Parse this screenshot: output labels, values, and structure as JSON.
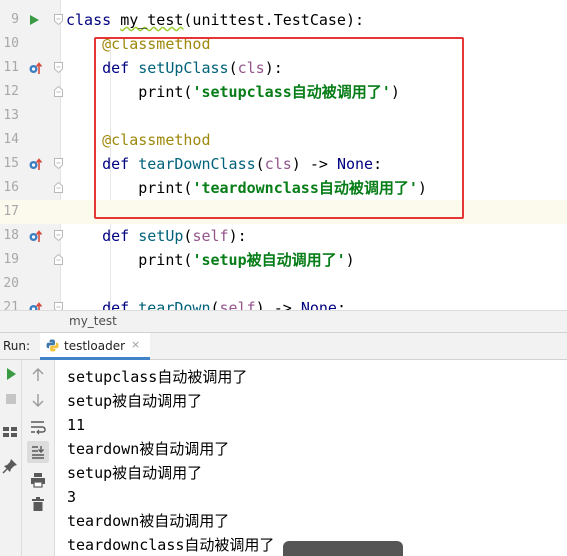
{
  "editor": {
    "lines": [
      {
        "num": "9",
        "tokens": [
          {
            "t": "class ",
            "c": "kw"
          },
          {
            "t": "my_test",
            "c": ""
          },
          {
            "t": "(unittest.TestCase):",
            "c": ""
          }
        ]
      },
      {
        "num": "10",
        "tokens": [
          {
            "t": "    @classmethod",
            "c": "dec"
          }
        ]
      },
      {
        "num": "11",
        "tokens": [
          {
            "t": "    def ",
            "c": "kw"
          },
          {
            "t": "setUpClass",
            "c": "fn"
          },
          {
            "t": "(",
            "c": ""
          },
          {
            "t": "cls",
            "c": "self"
          },
          {
            "t": "):",
            "c": ""
          }
        ]
      },
      {
        "num": "12",
        "tokens": [
          {
            "t": "        print(",
            "c": ""
          },
          {
            "t": "'setupclass",
            "c": "str"
          },
          {
            "t": "自动被调用了",
            "c": "str cjk"
          },
          {
            "t": "'",
            "c": "str"
          },
          {
            "t": ")",
            "c": ""
          }
        ]
      },
      {
        "num": "13",
        "tokens": []
      },
      {
        "num": "14",
        "tokens": [
          {
            "t": "    @classmethod",
            "c": "dec"
          }
        ]
      },
      {
        "num": "15",
        "tokens": [
          {
            "t": "    def ",
            "c": "kw"
          },
          {
            "t": "tearDownClass",
            "c": "fn"
          },
          {
            "t": "(",
            "c": ""
          },
          {
            "t": "cls",
            "c": "self"
          },
          {
            "t": ") -> ",
            "c": ""
          },
          {
            "t": "None",
            "c": "bi"
          },
          {
            "t": ":",
            "c": ""
          }
        ]
      },
      {
        "num": "16",
        "tokens": [
          {
            "t": "        print(",
            "c": ""
          },
          {
            "t": "'teardownclass",
            "c": "str"
          },
          {
            "t": "自动被调用了",
            "c": "str cjk"
          },
          {
            "t": "'",
            "c": "str"
          },
          {
            "t": ")",
            "c": ""
          }
        ]
      },
      {
        "num": "17",
        "tokens": []
      },
      {
        "num": "18",
        "tokens": [
          {
            "t": "    def ",
            "c": "kw"
          },
          {
            "t": "setUp",
            "c": "fn"
          },
          {
            "t": "(",
            "c": ""
          },
          {
            "t": "self",
            "c": "self"
          },
          {
            "t": "):",
            "c": ""
          }
        ]
      },
      {
        "num": "19",
        "tokens": [
          {
            "t": "        print(",
            "c": ""
          },
          {
            "t": "'setup",
            "c": "str"
          },
          {
            "t": "被自动调用了",
            "c": "str cjk"
          },
          {
            "t": "'",
            "c": "str"
          },
          {
            "t": ")",
            "c": ""
          }
        ]
      },
      {
        "num": "20",
        "tokens": []
      },
      {
        "num": "21",
        "tokens": [
          {
            "t": "    def ",
            "c": "kw"
          },
          {
            "t": "tearDown",
            "c": "fn"
          },
          {
            "t": "(",
            "c": ""
          },
          {
            "t": "self",
            "c": "self"
          },
          {
            "t": ") -> ",
            "c": ""
          },
          {
            "t": "None",
            "c": "bi"
          },
          {
            "t": ":",
            "c": ""
          }
        ]
      }
    ]
  },
  "breadcrumb": {
    "text": "my_test"
  },
  "run": {
    "label": "Run:",
    "tab_label": "testloader",
    "tab_close": "×",
    "output": [
      {
        "text": "setupclass",
        "cjk": "自动被调用了"
      },
      {
        "text": "setup",
        "cjk": "被自动调用了"
      },
      {
        "text": "11",
        "cjk": ""
      },
      {
        "text": "teardown",
        "cjk": "被自动调用了"
      },
      {
        "text": "setup",
        "cjk": "被自动调用了"
      },
      {
        "text": "3",
        "cjk": ""
      },
      {
        "text": "teardown",
        "cjk": "被自动调用了"
      },
      {
        "text": "teardownclass",
        "cjk": "自动被调用了"
      }
    ]
  },
  "icons": {
    "gutter_run": "run-arrow-icon",
    "gutter_override": "override-icon",
    "fold": "fold-marker-icon",
    "rerun": "rerun-icon",
    "stop": "stop-icon",
    "scroll_up": "arrow-up-icon",
    "scroll_down": "arrow-down-icon",
    "soft_wrap": "soft-wrap-icon",
    "scroll_end": "scroll-to-end-icon",
    "print": "print-icon",
    "trash": "trash-icon",
    "layout": "layout-icon",
    "pin": "pin-icon",
    "python": "python-icon"
  },
  "colors": {
    "keyword": "#000080",
    "function": "#00627a",
    "decorator": "#9e880d",
    "self": "#94558d",
    "string": "#067d17",
    "highlight_box": "#e53535",
    "run_green": "#3a9a44",
    "tab_underline": "#4083c9"
  }
}
